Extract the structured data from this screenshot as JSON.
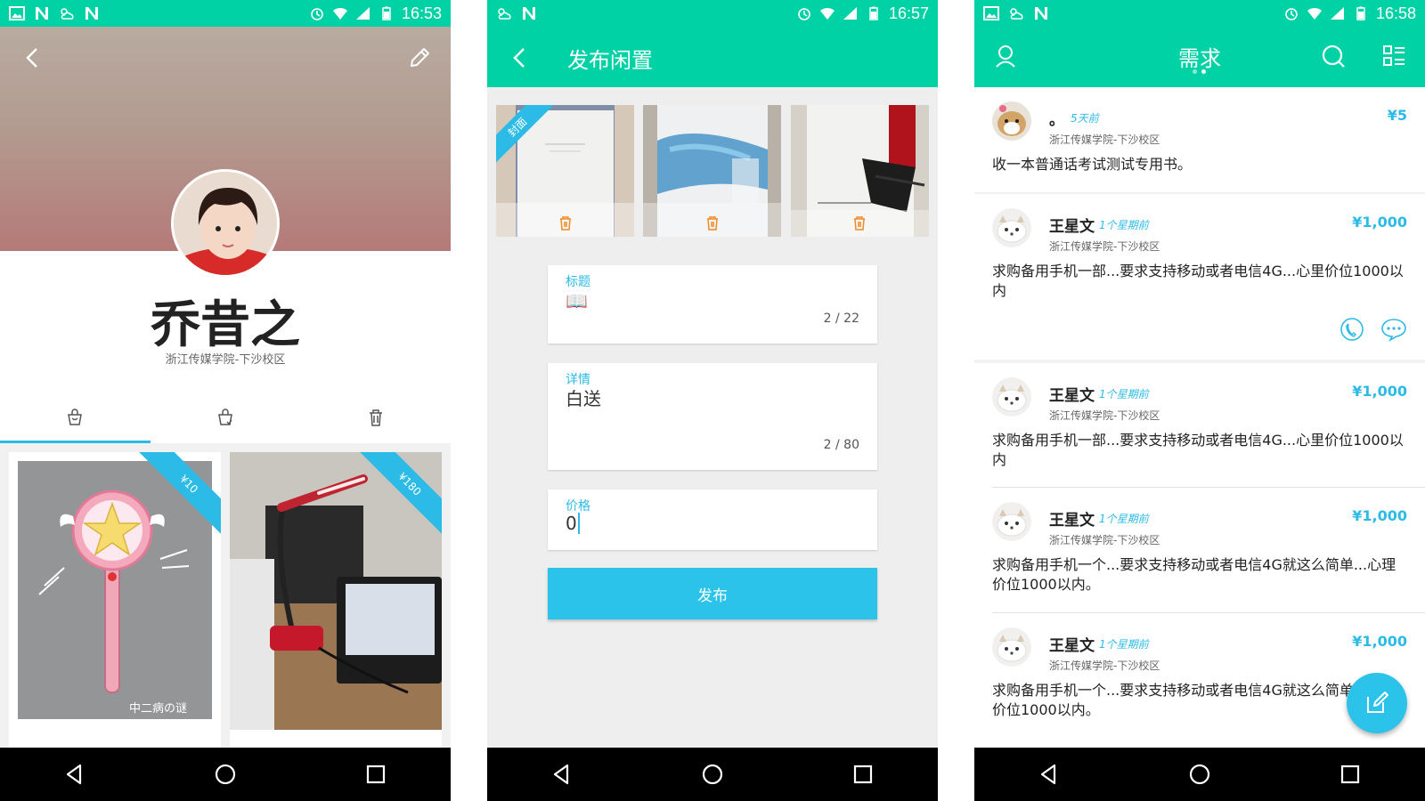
{
  "colors": {
    "primary": "#00d2a5",
    "accent": "#2bbbe6",
    "trash": "#f08a24"
  },
  "screen1": {
    "status_time": "16:53",
    "user_name": "乔昔之",
    "school": "浙江传媒学院-下沙校区",
    "tabs": [
      "basket-icon",
      "basket-heart-icon",
      "trash-icon"
    ],
    "items": [
      {
        "price_tag": "¥10",
        "watermark": "中二病の谜"
      },
      {
        "price_tag": "¥180"
      }
    ]
  },
  "screen2": {
    "status_time": "16:57",
    "title": "发布闲置",
    "cover_label": "封面",
    "fields": {
      "title": {
        "label": "标题",
        "value": "📖",
        "counter": "2 / 22"
      },
      "detail": {
        "label": "详情",
        "value": "白送",
        "counter": "2 / 80"
      },
      "price": {
        "label": "价格",
        "value": "0"
      }
    },
    "submit_label": "发布"
  },
  "screen3": {
    "status_time": "16:58",
    "title": "需求",
    "requests": [
      {
        "name": "。",
        "time": "5天前",
        "price": "¥5",
        "school": "浙江传媒学院-下沙校区",
        "text": "收一本普通话考试测试专用书。"
      },
      {
        "name": "王星文",
        "time": "1个星期前",
        "price": "¥1,000",
        "school": "浙江传媒学院-下沙校区",
        "text": "求购备用手机一部...要求支持移动或者电信4G...心里价位1000以内"
      },
      {
        "name": "王星文",
        "time": "1个星期前",
        "price": "¥1,000",
        "school": "浙江传媒学院-下沙校区",
        "text": "求购备用手机一部...要求支持移动或者电信4G...心里价位1000以内"
      },
      {
        "name": "王星文",
        "time": "1个星期前",
        "price": "¥1,000",
        "school": "浙江传媒学院-下沙校区",
        "text": "求购备用手机一个...要求支持移动或者电信4G就这么简单...心理价位1000以内。"
      },
      {
        "name": "王星文",
        "time": "1个星期前",
        "price": "¥1,000",
        "school": "浙江传媒学院-下沙校区",
        "text": "求购备用手机一个...要求支持移动或者电信4G就这么简单...心理价位1000以内。"
      }
    ]
  }
}
